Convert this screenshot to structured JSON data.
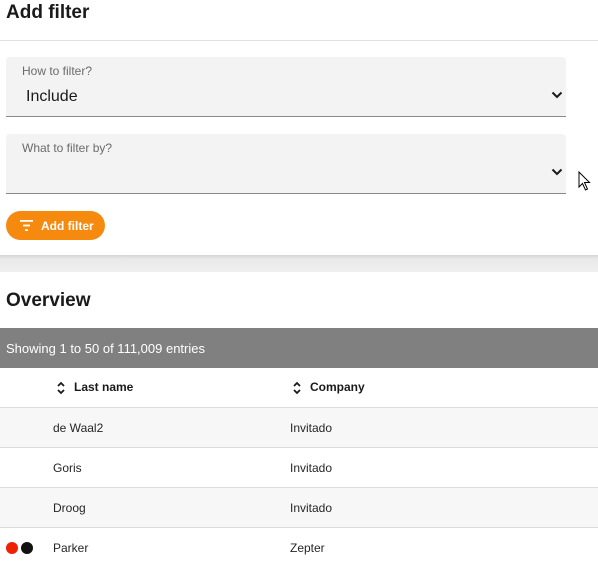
{
  "add_filter": {
    "title": "Add filter",
    "how": {
      "label": "How to filter?",
      "value": "Include"
    },
    "what": {
      "label": "What to filter by?",
      "value": ""
    },
    "button_label": "Add filter",
    "button_color": "#f68a0f"
  },
  "overview": {
    "title": "Overview",
    "entries_text": "Showing 1 to 50 of 111,009 entries",
    "bar_color": "#808080",
    "columns": [
      {
        "label": "Last name"
      },
      {
        "label": "Company"
      }
    ],
    "rows": [
      {
        "last_name": "de Waal2",
        "company": "Invitado",
        "status_dots": []
      },
      {
        "last_name": "Goris",
        "company": "Invitado",
        "status_dots": []
      },
      {
        "last_name": "Droog",
        "company": "Invitado",
        "status_dots": []
      },
      {
        "last_name": "Parker",
        "company": "Zepter",
        "status_dots": [
          "#ee2200",
          "#111111"
        ]
      }
    ]
  }
}
